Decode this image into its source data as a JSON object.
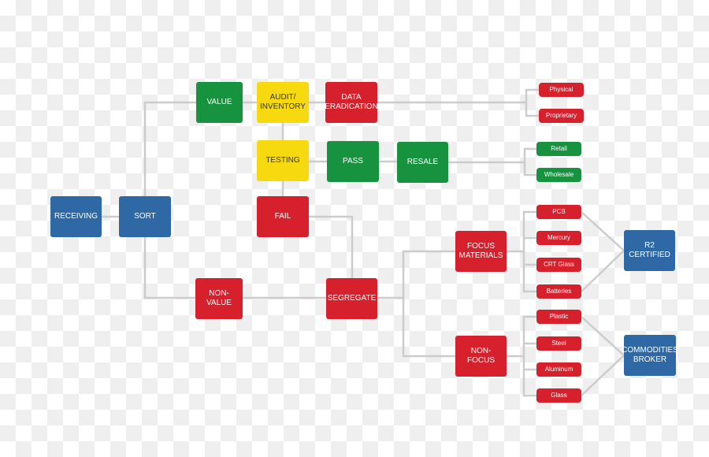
{
  "colors": {
    "red": "#d6202c",
    "green": "#17923f",
    "yellow": "#f7d90f",
    "blue": "#2e69a6",
    "connector": "#cccccc"
  },
  "nodes": {
    "receiving": "RECEIVING",
    "sort": "SORT",
    "value": "VALUE",
    "audit": "AUDIT/\nINVENTORY",
    "data_eradication": "DATA\nERADICATION",
    "testing": "TESTING",
    "pass": "PASS",
    "resale": "RESALE",
    "fail": "FAIL",
    "non_value": "NON-\nVALUE",
    "segregate": "SEGREGATE",
    "focus_materials": "FOCUS\nMATERIALS",
    "non_focus": "NON-\nFOCUS",
    "r2_certified": "R2\nCERTIFIED",
    "commodities_broker": "COMMODITIES\nBROKER"
  },
  "eradication_types": [
    "Physical",
    "Proprietary"
  ],
  "resale_types": [
    "Retail",
    "Wholesale"
  ],
  "focus_items": [
    "PCB",
    "Mercury",
    "CRT Glass",
    "Batteries"
  ],
  "non_focus_items": [
    "Plastic",
    "Steel",
    "Aluminum",
    "Glass"
  ]
}
